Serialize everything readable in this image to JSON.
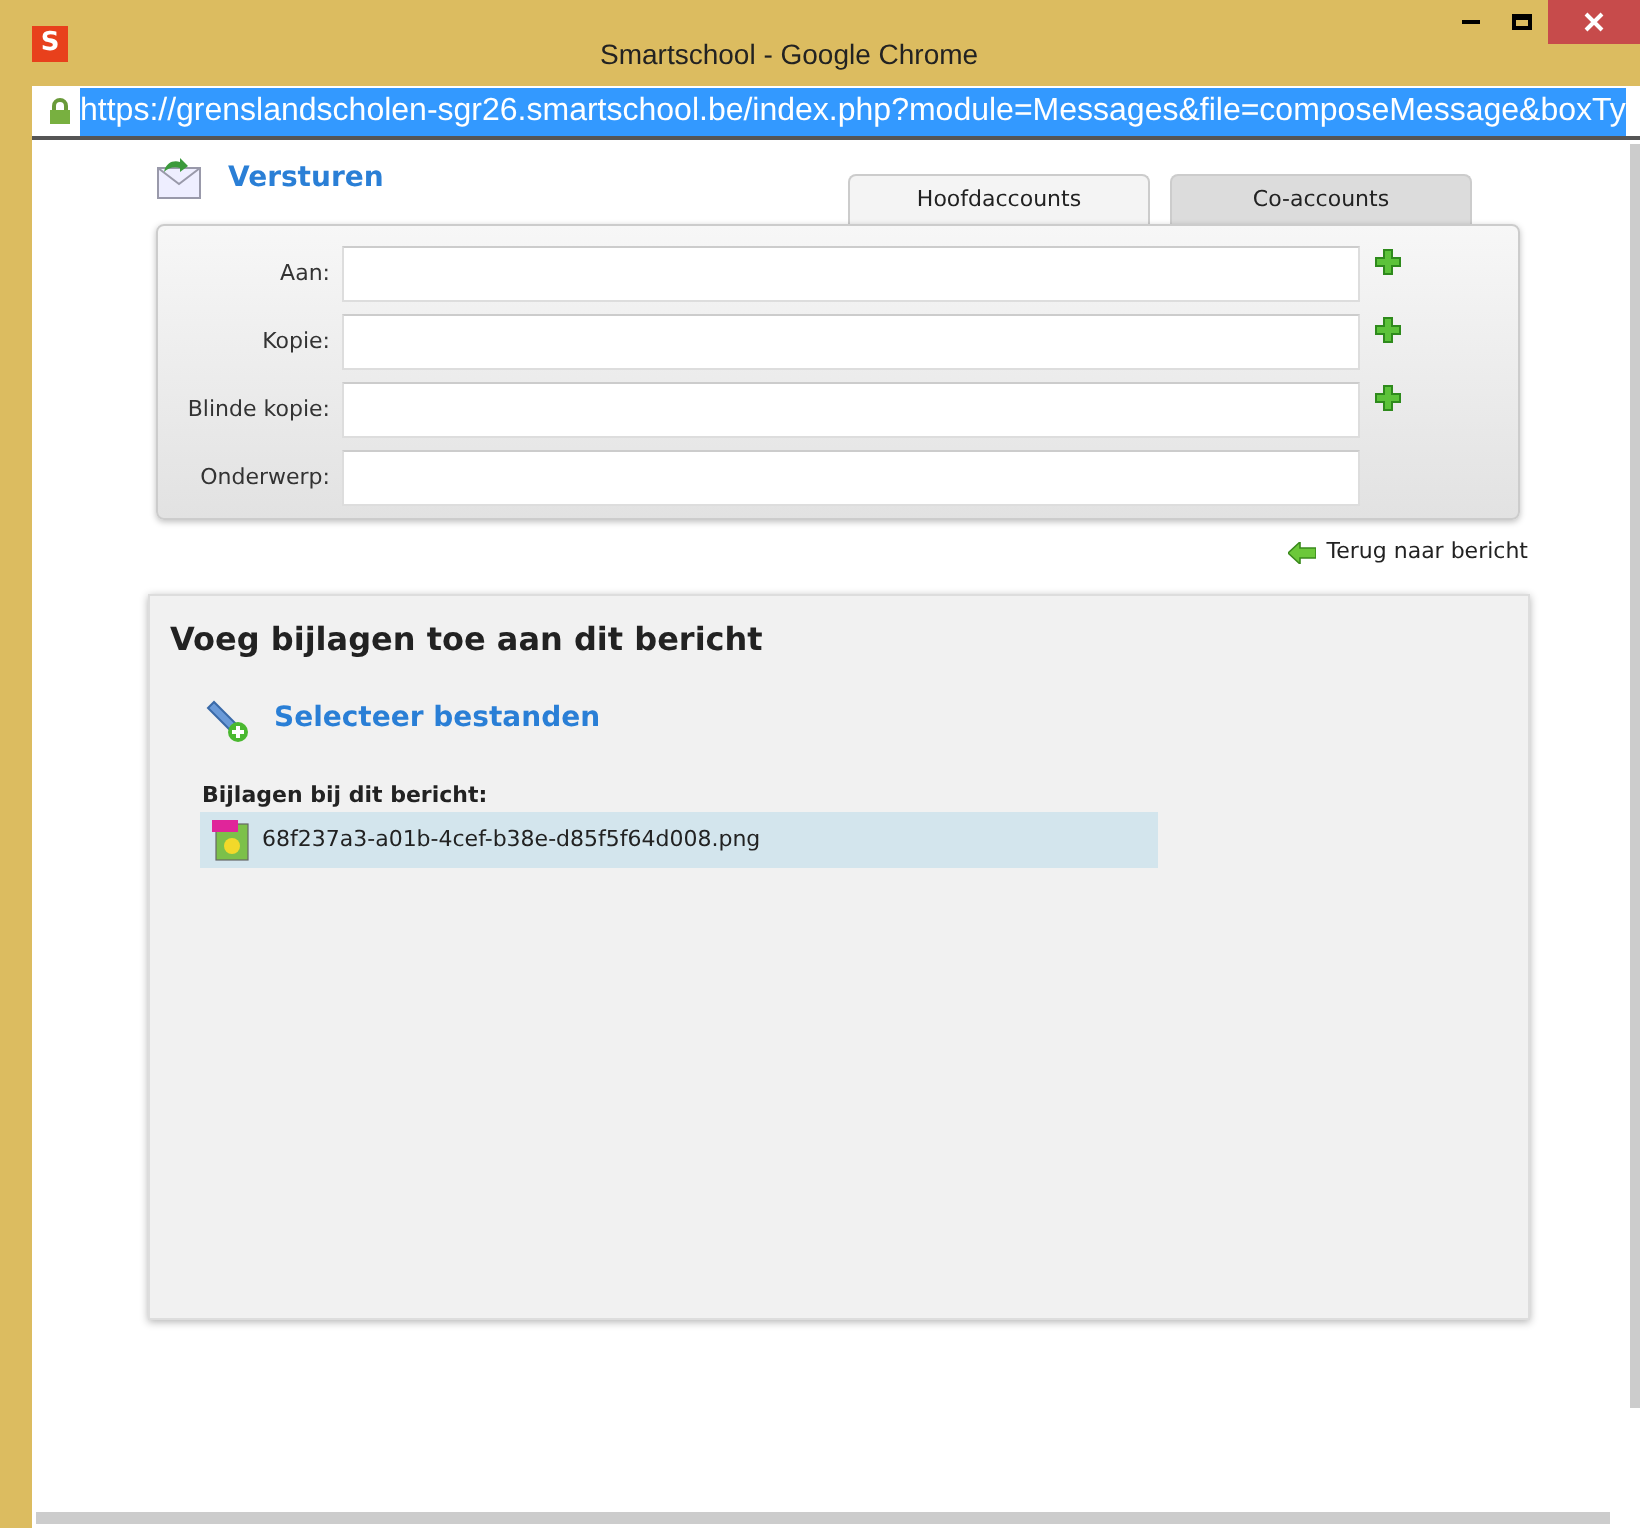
{
  "window": {
    "title": "Smartschool - Google Chrome",
    "app_letter": "S"
  },
  "address_bar": {
    "url": "https://grenslandscholen-sgr26.smartschool.be/index.php?module=Messages&file=composeMessage&boxTy",
    "selected": true
  },
  "page": {
    "title": "Versturen"
  },
  "tabs": [
    {
      "label": "Hoofdaccounts",
      "selected": true
    },
    {
      "label": "Co-accounts",
      "selected": false
    }
  ],
  "fields": [
    {
      "label": "Aan:",
      "add_button": true
    },
    {
      "label": "Kopie:",
      "add_button": true
    },
    {
      "label": "Blinde kopie:",
      "add_button": true
    },
    {
      "label": "Onderwerp:",
      "add_button": false
    }
  ],
  "back_link": "Terug naar bericht",
  "attachments": {
    "title": "Voeg bijlagen toe aan dit bericht",
    "select_link": "Selecteer bestanden",
    "list_label": "Bijlagen bij dit bericht:",
    "files": [
      {
        "name": "68f237a3-a01b-4cef-b38e-d85f5f64d008.png",
        "selected": true
      }
    ]
  }
}
